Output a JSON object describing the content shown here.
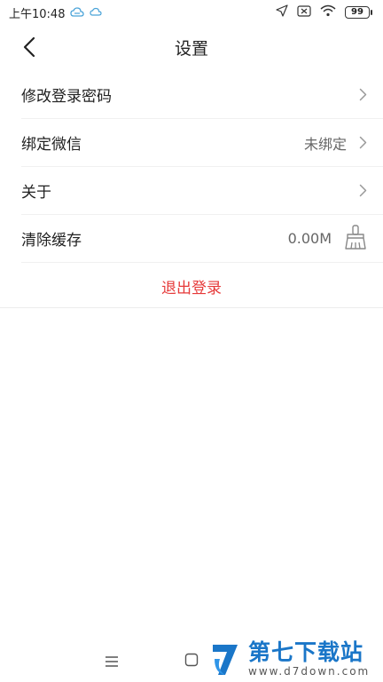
{
  "status_bar": {
    "time": "上午10:48",
    "battery": "99"
  },
  "header": {
    "title": "设置"
  },
  "settings": {
    "items": [
      {
        "label": "修改登录密码",
        "value": ""
      },
      {
        "label": "绑定微信",
        "value": "未绑定"
      },
      {
        "label": "关于",
        "value": ""
      },
      {
        "label": "清除缓存",
        "value": "0.00M"
      }
    ],
    "logout_label": "退出登录"
  },
  "watermark": {
    "title": "第七下载站",
    "url": "www.d7down.com"
  },
  "colors": {
    "accent_red": "#e63a3a",
    "watermark_blue": "#1a76c8"
  }
}
